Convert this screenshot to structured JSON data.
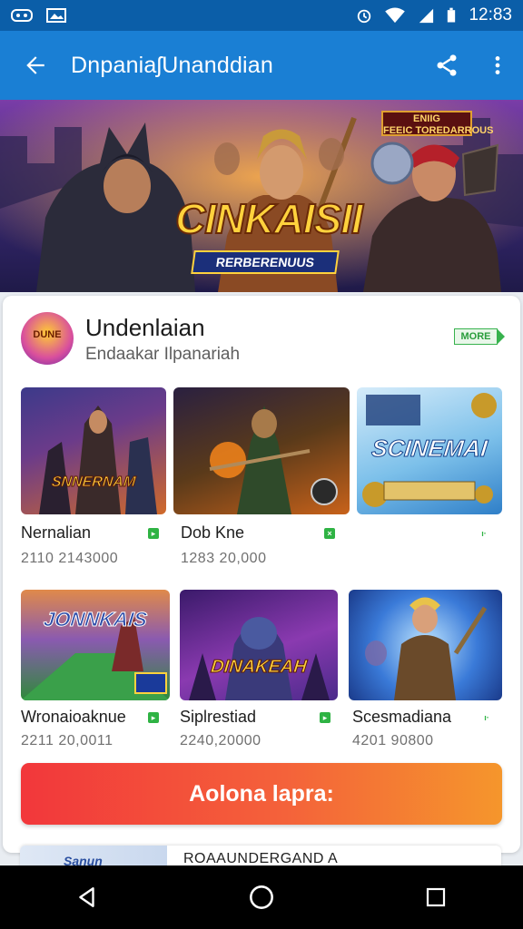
{
  "status_bar": {
    "time": "12:83",
    "left_icons": [
      "gamepad-icon",
      "image-notification-icon"
    ],
    "right_icons": [
      "alarm-icon",
      "wifi-icon",
      "signal-icon",
      "battery-icon"
    ]
  },
  "app_bar": {
    "title": "DnpaniaʃUnanddian",
    "actions": [
      "share-icon",
      "more-vert-icon"
    ]
  },
  "banner": {
    "tag_text": "ENIIG FEEIC TOREDARROUS",
    "logo_title": "CINKAISII",
    "logo_subtitle": "RERBERENUUS"
  },
  "app_header": {
    "name": "Undenlaian",
    "subtitle": "Endaakar Ilpanariah",
    "badge": "MORE"
  },
  "tiles": [
    {
      "name": "Nernalian",
      "count": "2110 2143000",
      "caption": "SNNERNAM",
      "has_flag": true
    },
    {
      "name": "Dob Kne",
      "count": "1283 20,000",
      "caption": "",
      "has_flag": true
    },
    {
      "name": "",
      "count": "",
      "caption": "SCINEMAI",
      "has_flag": true
    },
    {
      "name": "Wronaioaknue",
      "count": "2211 20,0011",
      "caption": "JONNKAIS",
      "has_flag": true
    },
    {
      "name": "Siplrestiad",
      "count": "2240,20000",
      "caption": "DINAKEAH",
      "has_flag": true
    },
    {
      "name": "Scesmadiana",
      "count": "4201 90800",
      "caption": "",
      "has_flag": true
    }
  ],
  "cta": {
    "label": "Aolona lapra:"
  },
  "next_card": {
    "thumb_text": "Sanun",
    "title": "ROAAUNDERGAND A"
  },
  "nav": [
    "back-nav-icon",
    "home-nav-icon",
    "recents-nav-icon"
  ],
  "colors": {
    "status_bar": "#0b5ea8",
    "app_bar": "#1a7fd4",
    "cta_start": "#f2373b",
    "cta_end": "#f5962c",
    "flag_green": "#2fb344"
  }
}
